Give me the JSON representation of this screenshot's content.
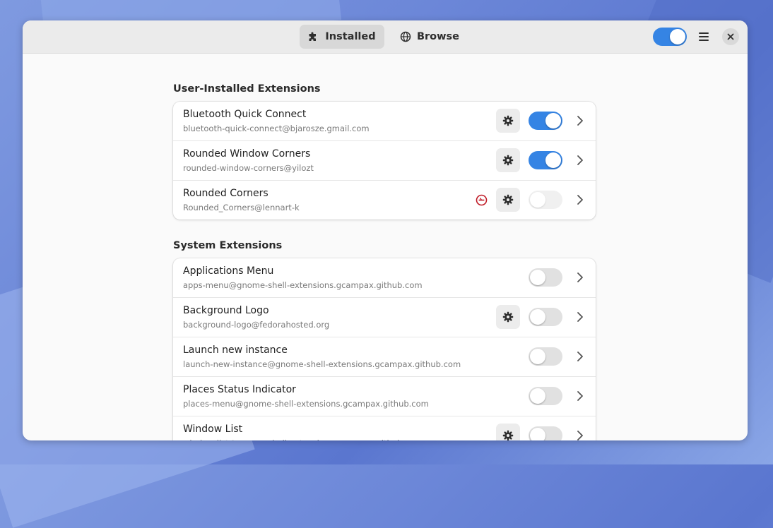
{
  "header": {
    "tabs": [
      {
        "label": "Installed",
        "icon": "puzzle-icon",
        "active": true
      },
      {
        "label": "Browse",
        "icon": "globe-icon",
        "active": false
      }
    ],
    "extensions_enabled": true
  },
  "user_section": {
    "title": "User-Installed Extensions",
    "items": [
      {
        "name": "Bluetooth Quick Connect",
        "uuid": "bluetooth-quick-connect@bjarosze.gmail.com",
        "has_settings": true,
        "enabled": true,
        "error": false
      },
      {
        "name": "Rounded Window Corners",
        "uuid": "rounded-window-corners@yilozt",
        "has_settings": true,
        "enabled": true,
        "error": false
      },
      {
        "name": "Rounded Corners",
        "uuid": "Rounded_Corners@lennart-k",
        "has_settings": true,
        "enabled": false,
        "error": true
      }
    ]
  },
  "system_section": {
    "title": "System Extensions",
    "items": [
      {
        "name": "Applications Menu",
        "uuid": "apps-menu@gnome-shell-extensions.gcampax.github.com",
        "has_settings": false,
        "enabled": false
      },
      {
        "name": "Background Logo",
        "uuid": "background-logo@fedorahosted.org",
        "has_settings": true,
        "enabled": false
      },
      {
        "name": "Launch new instance",
        "uuid": "launch-new-instance@gnome-shell-extensions.gcampax.github.com",
        "has_settings": false,
        "enabled": false
      },
      {
        "name": "Places Status Indicator",
        "uuid": "places-menu@gnome-shell-extensions.gcampax.github.com",
        "has_settings": false,
        "enabled": false
      },
      {
        "name": "Window List",
        "uuid": "window-list@gnome-shell-extensions.gcampax.github.com",
        "has_settings": true,
        "enabled": false
      }
    ]
  },
  "colors": {
    "accent": "#3584e4",
    "error": "#c01c28"
  }
}
